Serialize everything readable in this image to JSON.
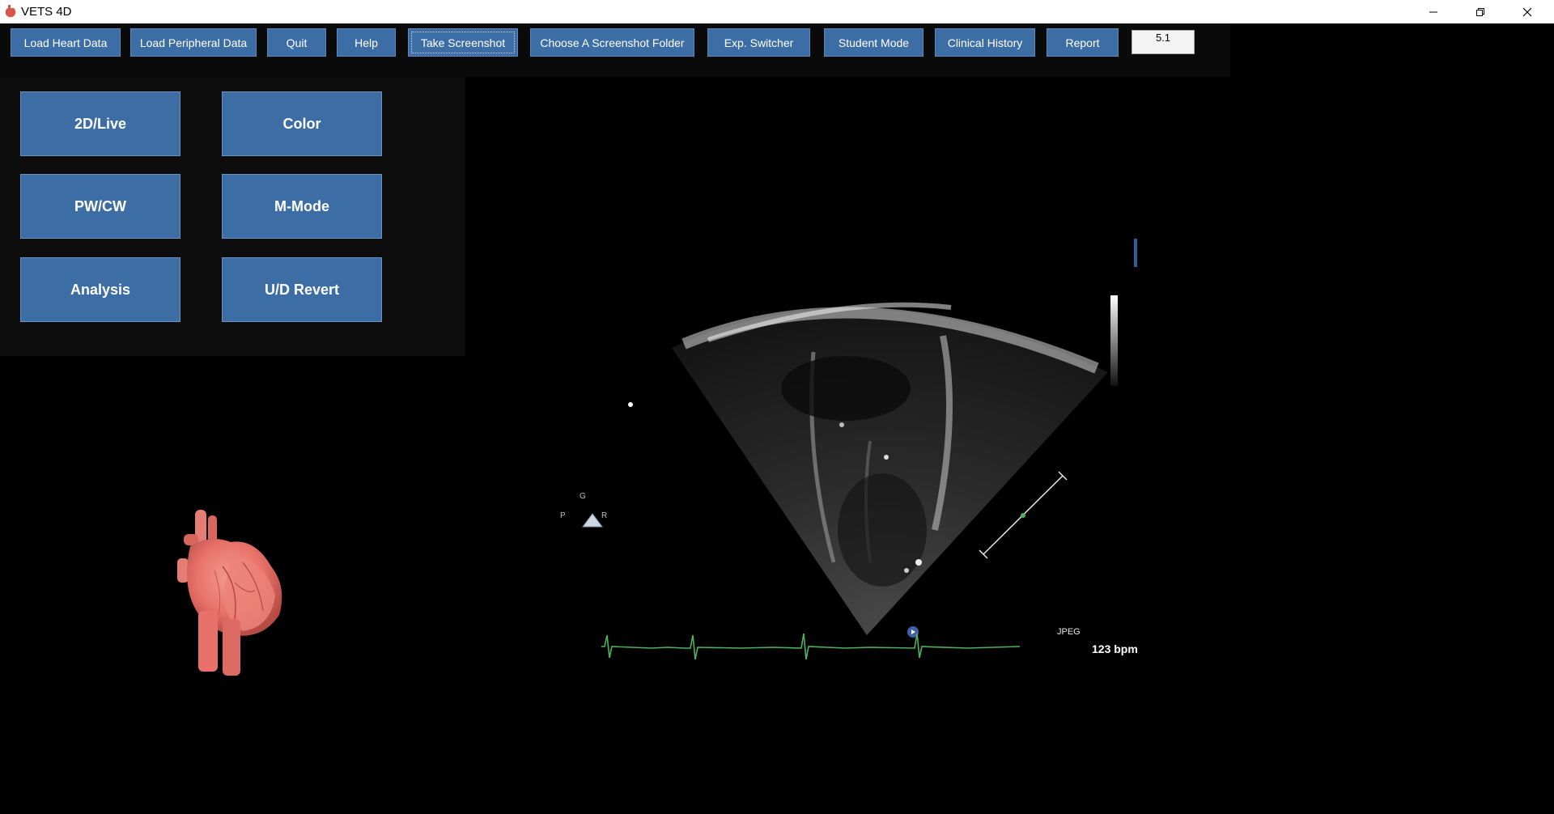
{
  "window": {
    "title": "VETS 4D",
    "controls": [
      "minimize-icon",
      "restore-icon",
      "close-icon"
    ]
  },
  "toolbar": {
    "buttons": [
      "Load Heart Data",
      "Load Peripheral Data",
      "Quit",
      "Help",
      "Take Screenshot",
      "Choose A Screenshot Folder",
      "Exp. Switcher",
      "Student Mode",
      "Clinical History",
      "Report"
    ],
    "focused_button": "Take Screenshot",
    "version": "5.1"
  },
  "modes": {
    "buttons": [
      "2D/Live",
      "Color",
      "PW/CW",
      "M-Mode",
      "Analysis",
      "U/D Revert"
    ]
  },
  "viewer": {
    "orientation": {
      "top": "G",
      "left": "P",
      "right": "R"
    },
    "format_label": "JPEG",
    "heart_rate": "123 bpm",
    "ecg_color": "#4fb35b"
  },
  "model": {
    "icon": "heart-3d-model-icon",
    "color": "#e8726a"
  },
  "colors": {
    "button_blue": "#3d6da5",
    "background": "#000000"
  }
}
